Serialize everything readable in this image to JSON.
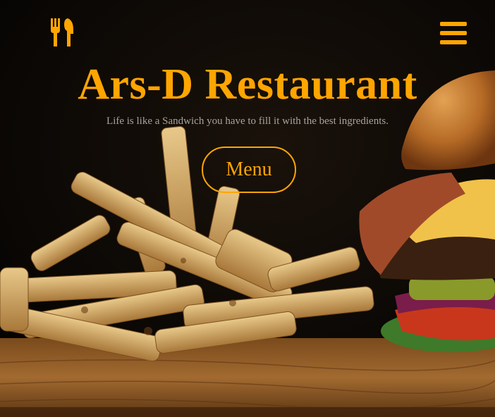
{
  "header": {
    "logo_icon": "fork-knife-icon",
    "menu_icon": "hamburger-menu-icon"
  },
  "hero": {
    "title": "Ars-D Restaurant",
    "tagline": "Life is like a Sandwich you have to fill it with the best ingredients.",
    "cta_label": "Menu",
    "background_image": "burger-and-fries-photo"
  },
  "colors": {
    "accent": "#ffa500",
    "tagline": "#a9a39a",
    "background": "#050403"
  }
}
